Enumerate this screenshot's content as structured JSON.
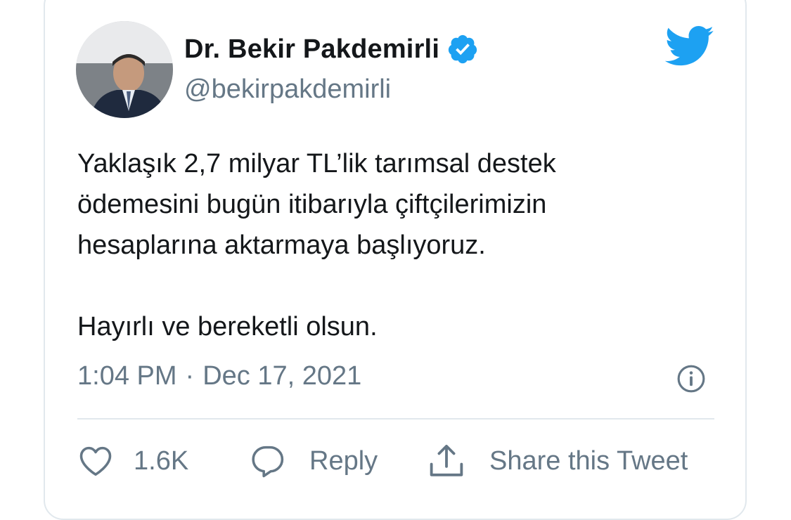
{
  "author": {
    "display_name": "Dr. Bekir Pakdemirli",
    "handle": "@bekirpakdemirli",
    "verified": true
  },
  "tweet": {
    "lines": [
      "Yaklaşık 2,7 milyar TL’lik tarımsal destek",
      "ödemesini bugün itibarıyla çiftçilerimizin",
      "hesaplarına aktarmaya başlıyoruz.",
      "Hayırlı ve bereketli olsun."
    ],
    "time": "1:04 PM",
    "separator": "·",
    "date": "Dec 17, 2021"
  },
  "actions": {
    "like_count": "1.6K",
    "reply_label": "Reply",
    "share_label": "Share this Tweet"
  },
  "colors": {
    "twitter_blue": "#1da1f2",
    "text_primary": "#14171a",
    "text_secondary": "#657786",
    "border": "#e1e8ed"
  },
  "icons": [
    "avatar",
    "verified-badge-icon",
    "twitter-bird-icon",
    "info-icon",
    "heart-icon",
    "reply-bubble-icon",
    "share-icon"
  ]
}
